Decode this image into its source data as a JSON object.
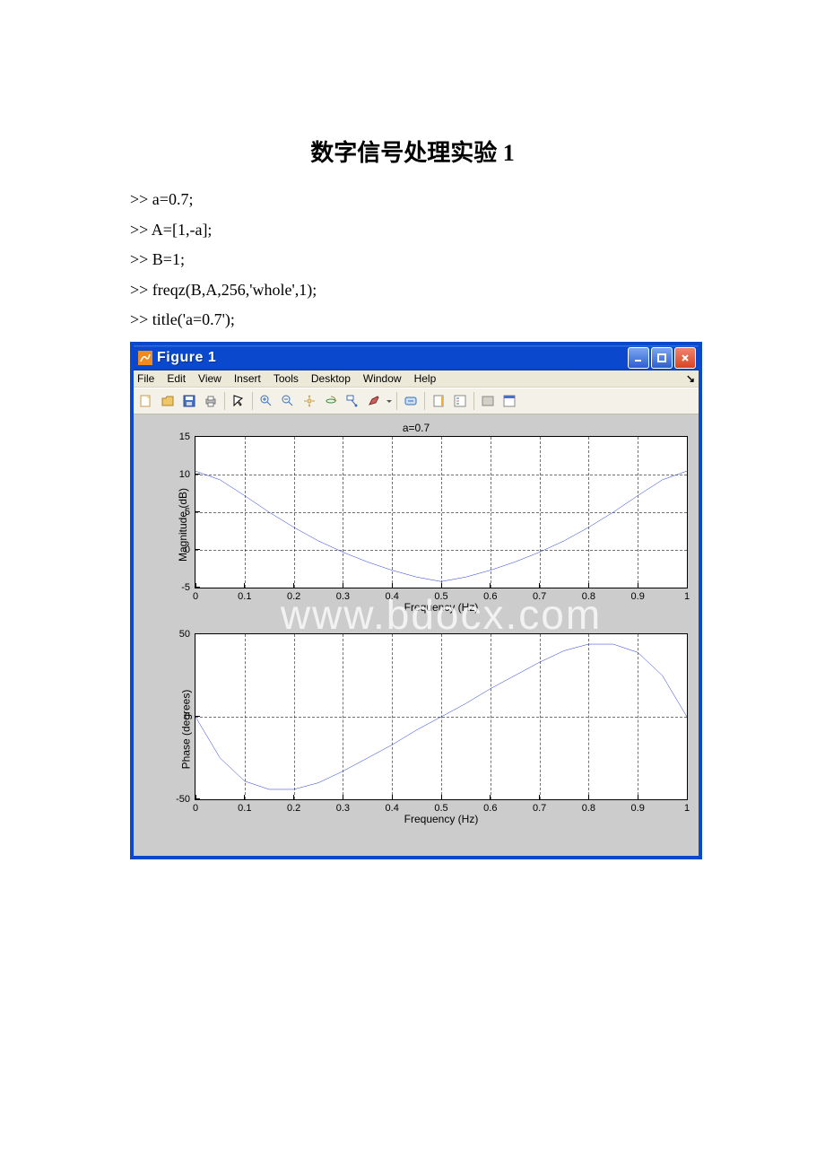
{
  "page": {
    "title": "数字信号处理实验 1"
  },
  "code": {
    "lines": [
      ">> a=0.7;",
      ">> A=[1,-a];",
      ">> B=1;",
      ">> freqz(B,A,256,'whole',1);",
      ">> title('a=0.7');"
    ]
  },
  "window": {
    "title": "Figure 1"
  },
  "menu": {
    "file": "File",
    "edit": "Edit",
    "view": "View",
    "insert": "Insert",
    "tools": "Tools",
    "desktop": "Desktop",
    "window": "Window",
    "help": "Help"
  },
  "chart_data": [
    {
      "type": "line",
      "title": "a=0.7",
      "xlabel": "Frequency (Hz)",
      "ylabel": "Magnitude (dB)",
      "xlim": [
        0,
        1
      ],
      "ylim": [
        -5,
        15
      ],
      "xticks": [
        0,
        0.1,
        0.2,
        0.3,
        0.4,
        0.5,
        0.6,
        0.7,
        0.8,
        0.9,
        1
      ],
      "yticks": [
        -5,
        0,
        5,
        10,
        15
      ],
      "series": [
        {
          "name": "magnitude",
          "x": [
            0,
            0.05,
            0.1,
            0.15,
            0.2,
            0.25,
            0.3,
            0.35,
            0.4,
            0.45,
            0.5,
            0.55,
            0.6,
            0.65,
            0.7,
            0.75,
            0.8,
            0.85,
            0.9,
            0.95,
            1
          ],
          "values": [
            10.46,
            9.3,
            7.2,
            5.0,
            3.0,
            1.2,
            -0.3,
            -1.6,
            -2.7,
            -3.6,
            -4.2,
            -3.6,
            -2.7,
            -1.6,
            -0.3,
            1.2,
            3.0,
            5.0,
            7.2,
            9.3,
            10.46
          ]
        }
      ]
    },
    {
      "type": "line",
      "xlabel": "Frequency (Hz)",
      "ylabel": "Phase (degrees)",
      "xlim": [
        0,
        1
      ],
      "ylim": [
        -50,
        50
      ],
      "xticks": [
        0,
        0.1,
        0.2,
        0.3,
        0.4,
        0.5,
        0.6,
        0.7,
        0.8,
        0.9,
        1
      ],
      "yticks": [
        -50,
        0,
        50
      ],
      "series": [
        {
          "name": "phase",
          "x": [
            0,
            0.05,
            0.1,
            0.15,
            0.2,
            0.25,
            0.3,
            0.35,
            0.4,
            0.45,
            0.5,
            0.55,
            0.6,
            0.65,
            0.7,
            0.75,
            0.8,
            0.85,
            0.9,
            0.95,
            1
          ],
          "values": [
            0,
            -25,
            -39,
            -44,
            -44,
            -40,
            -33,
            -25,
            -17,
            -8,
            0,
            8,
            17,
            25,
            33,
            40,
            44,
            44,
            39,
            25,
            0
          ]
        }
      ]
    }
  ],
  "watermark": "www.bdocx.com"
}
